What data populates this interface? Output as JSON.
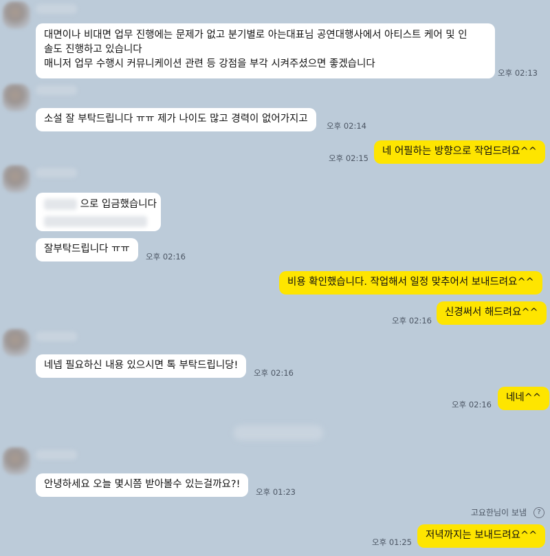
{
  "messages": {
    "m1": {
      "text_line1": "대면이나 비대면 업무 진행에는 문제가 없고 분기별로 아는대표님 공연대행사에서 아티스트 케어 및 인",
      "text_line2": "솔도 진행하고 있습니다",
      "text_line3": "매니저 업무 수행시 커뮤니케이션 관련 등 강점을 부각 시켜주셨으면 좋겠습니다",
      "time": "오후 02:13"
    },
    "m2": {
      "text": "소설 잘 부탁드립니다 ㅠㅠ 제가 나이도 많고 경력이 없어가지고",
      "time": "오후 02:14"
    },
    "m3": {
      "text": "네 어필하는 방향으로 작업드려요^^",
      "time": "오후 02:15"
    },
    "m4": {
      "text": "으로 입금했습니다"
    },
    "m5": {
      "text": "잘부탁드립니다 ㅠㅠ",
      "time": "오후 02:16"
    },
    "m6": {
      "text": "비용 확인했습니다. 작업해서 일정 맞추어서 보내드려요^^"
    },
    "m7": {
      "text": "신경써서 해드려요^^",
      "time": "오후 02:16"
    },
    "m8": {
      "text": "네넵 필요하신 내용 있으시면 톡 부탁드립니당!",
      "time": "오후 02:16"
    },
    "m9": {
      "text": "네네^^",
      "time": "오후 02:16"
    },
    "m10": {
      "text": "안녕하세요 오늘 몇시쯤 받아볼수 있는걸까요?!",
      "time": "오후 01:23"
    },
    "m11": {
      "text": "저녁까지는 보내드려요^^",
      "time": "오후 01:25"
    }
  },
  "notice": {
    "text": "고요한님이 보냄",
    "icon": "help-icon"
  },
  "colors": {
    "background": "#bccbd9",
    "sent_bubble": "#fee500",
    "received_bubble": "#ffffff"
  }
}
